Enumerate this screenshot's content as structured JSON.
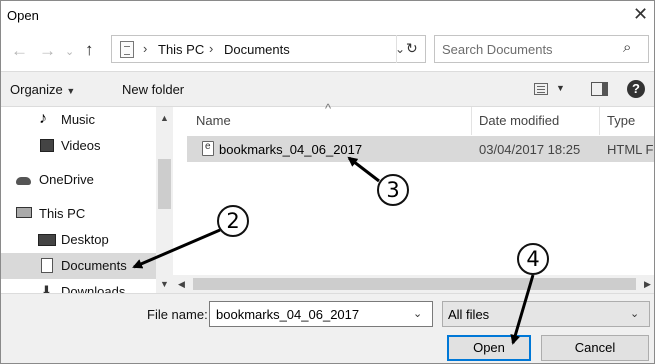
{
  "window": {
    "title": "Open"
  },
  "address": {
    "segments": [
      "This PC",
      "Documents"
    ],
    "separator": "›"
  },
  "search": {
    "placeholder": "Search Documents"
  },
  "toolbar": {
    "organize": "Organize",
    "new_folder": "New folder"
  },
  "sidebar": {
    "items": [
      {
        "label": "Music",
        "icon": "music-note-icon"
      },
      {
        "label": "Videos",
        "icon": "film-icon"
      },
      {
        "label": "OneDrive",
        "icon": "cloud-icon"
      },
      {
        "label": "This PC",
        "icon": "computer-icon"
      },
      {
        "label": "Desktop",
        "icon": "desktop-icon"
      },
      {
        "label": "Documents",
        "icon": "document-icon",
        "selected": true
      },
      {
        "label": "Downloads",
        "icon": "download-icon"
      }
    ]
  },
  "file_list": {
    "columns": [
      "Name",
      "Date modified",
      "Type"
    ],
    "rows": [
      {
        "name": "bookmarks_04_06_2017",
        "date": "03/04/2017 18:25",
        "type": "HTML Fi"
      }
    ]
  },
  "bottom": {
    "file_name_label": "File name:",
    "file_name_value": "bookmarks_04_06_2017",
    "file_type_value": "All files",
    "open": "Open",
    "cancel": "Cancel"
  },
  "callouts": [
    "2",
    "3",
    "4"
  ],
  "colors": {
    "accent": "#0078d7",
    "selected_row": "#d9d9d9"
  }
}
